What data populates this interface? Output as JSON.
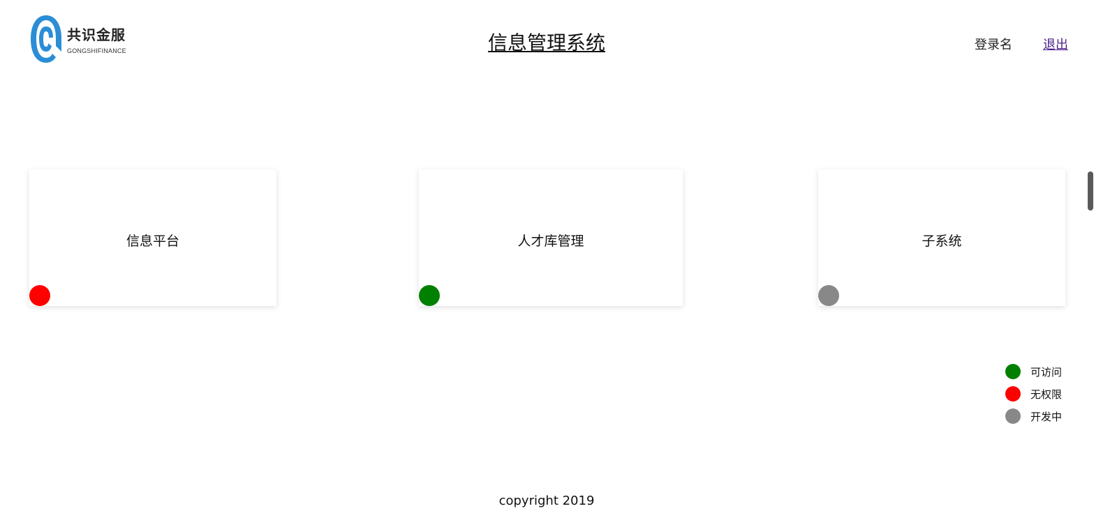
{
  "header": {
    "logo": {
      "name_cn": "共识金服",
      "name_en": "GONGSHIFINANCE",
      "icon": "gongshi-logo-icon",
      "color": "#2b8dd6"
    },
    "title": "信息管理系统",
    "username": "登录名",
    "logout_label": "退出"
  },
  "cards": [
    {
      "label": "信息平台",
      "status": "无权限",
      "status_color": "#ff0000"
    },
    {
      "label": "人才库管理",
      "status": "可访问",
      "status_color": "#008000"
    },
    {
      "label": "子系统",
      "status": "开发中",
      "status_color": "#888888"
    }
  ],
  "legend": [
    {
      "label": "可访问",
      "color": "#008000"
    },
    {
      "label": "无权限",
      "color": "#ff0000"
    },
    {
      "label": "开发中",
      "color": "#888888"
    }
  ],
  "footer": {
    "copyright": "copyright 2019"
  }
}
